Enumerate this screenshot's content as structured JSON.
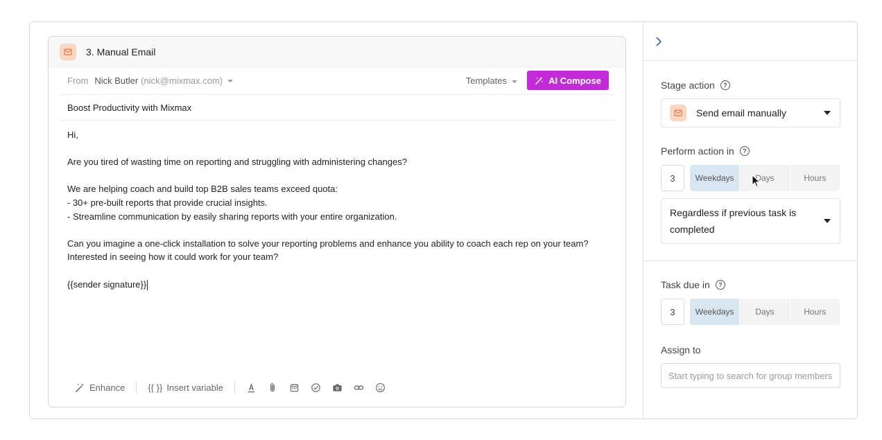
{
  "composer": {
    "title": "3. Manual Email",
    "from_label": "From",
    "from_name": "Nick Butler",
    "from_email": "(nick@mixmax.com)",
    "templates_label": "Templates",
    "ai_compose_label": "AI Compose",
    "subject": "Boost Productivity with Mixmax",
    "body_lines": [
      "Hi,",
      "",
      "Are you tired of wasting time on reporting and struggling with administering changes?",
      "",
      "We are helping coach and build top B2B sales teams exceed quota:",
      "- 30+ pre-built reports that provide crucial insights.",
      "- Streamline communication by easily sharing reports with your entire organization.",
      "",
      "Can you imagine a one-click installation to solve your reporting problems and enhance you ability to coach each rep on your team?",
      "Interested in seeing how it could work for your team?",
      "",
      "{{sender signature}}"
    ],
    "toolbar": {
      "enhance_label": "Enhance",
      "insert_variable_label": "Insert variable",
      "insert_variable_glyph": "{{ }}"
    }
  },
  "panel": {
    "stage_action_label": "Stage action",
    "stage_action_value": "Send email manually",
    "perform_action_label": "Perform action in",
    "perform_number": "3",
    "units": [
      "Weekdays",
      "Days",
      "Hours"
    ],
    "perform_active_unit": "Weekdays",
    "condition_value": "Regardless if previous task is completed",
    "task_due_label": "Task due in",
    "task_due_number": "3",
    "task_due_active_unit": "Weekdays",
    "assign_label": "Assign to",
    "assign_placeholder": "Start typing to search for group members"
  },
  "colors": {
    "accent_ai": "#c42bd8",
    "mail_badge": "#fbd7c2",
    "segment_active": "#d8e6f2",
    "chevron": "#3a5fc8"
  }
}
